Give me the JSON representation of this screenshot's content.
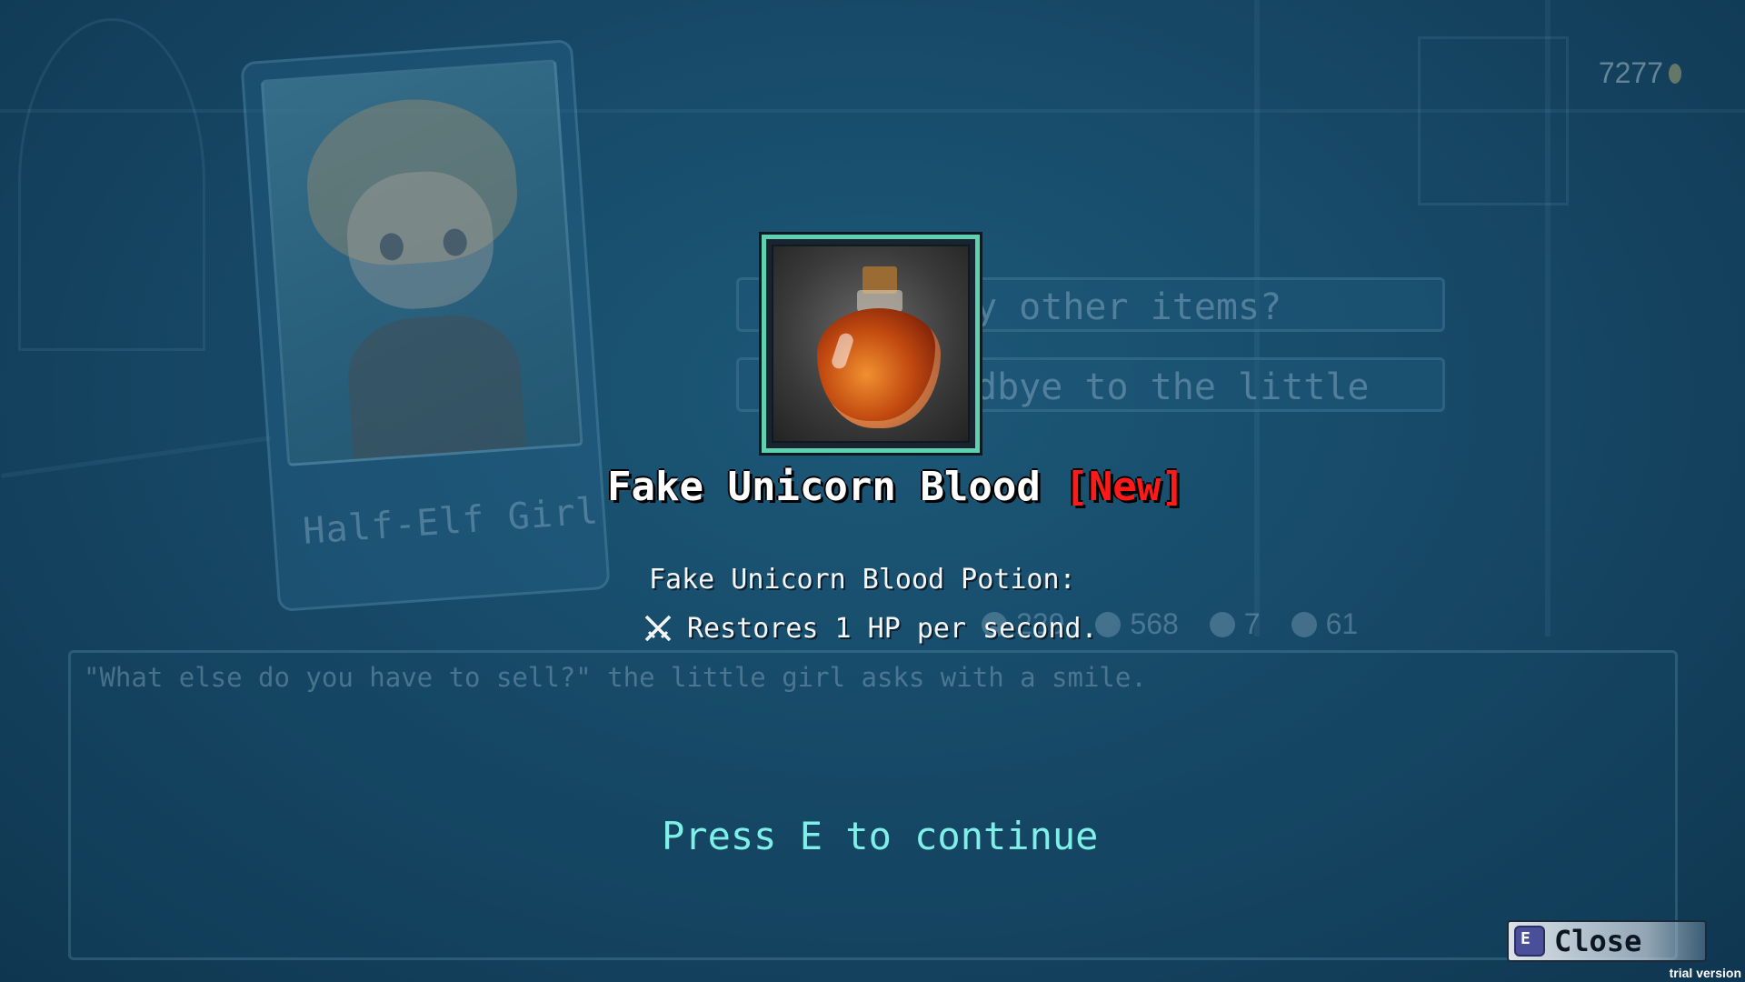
{
  "hud": {
    "gold_amount": "7277"
  },
  "background": {
    "character_name": "Half-Elf Girl",
    "choices": [
      {
        "text": "y other items?"
      },
      {
        "text": "dbye to the little"
      }
    ],
    "stats": [
      {
        "icon": "pentagram-icon",
        "value": "229"
      },
      {
        "icon": "water-icon",
        "value": "568"
      },
      {
        "icon": "wing-icon",
        "value": "7"
      },
      {
        "icon": "clover-icon",
        "value": "61"
      }
    ],
    "dialog_text": "\"What else do you have to sell?\" the little girl asks with a smile."
  },
  "item_popup": {
    "name": "Fake Unicorn Blood",
    "new_tag": "[New]",
    "description_title": "Fake Unicorn Blood Potion:",
    "effect_text": "Restores 1 HP per second.",
    "effect_icon": "crossed-swords-icon",
    "continue_prompt": "Press E to continue"
  },
  "controls": {
    "close_key": "E",
    "close_label": "Close"
  },
  "watermark": "trial version",
  "colors": {
    "frame_accent": "#5fd0b0",
    "new_tag": "#ff1a1a",
    "prompt": "#7ff0e8"
  }
}
